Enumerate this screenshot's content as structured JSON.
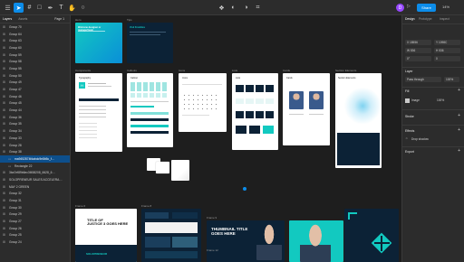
{
  "toolbar": {
    "icons": [
      "menu-icon",
      "move-icon",
      "frame-icon",
      "shape-icon",
      "pen-icon",
      "text-icon",
      "hand-icon",
      "comment-icon",
      "component-icon",
      "mask-icon",
      "contrast-icon",
      "crop-icon"
    ],
    "avatar_initial": "D",
    "share_label": "Share",
    "zoom": "14%"
  },
  "left": {
    "tabs": [
      "Layers",
      "Assets"
    ],
    "page_label": "Page 1",
    "layers": [
      {
        "name": "Group 70",
        "sel": false,
        "sub": false
      },
      {
        "name": "Group 64",
        "sel": false,
        "sub": false
      },
      {
        "name": "Group 63",
        "sel": false,
        "sub": false
      },
      {
        "name": "Group 60",
        "sel": false,
        "sub": false
      },
      {
        "name": "Group 59",
        "sel": false,
        "sub": false
      },
      {
        "name": "Group 58",
        "sel": false,
        "sub": false
      },
      {
        "name": "Group 55",
        "sel": false,
        "sub": false
      },
      {
        "name": "Group 50",
        "sel": false,
        "sub": false
      },
      {
        "name": "Group 49",
        "sel": false,
        "sub": false
      },
      {
        "name": "Group 47",
        "sel": false,
        "sub": false
      },
      {
        "name": "Group 46",
        "sel": false,
        "sub": false
      },
      {
        "name": "Group 45",
        "sel": false,
        "sub": false
      },
      {
        "name": "Group 44",
        "sel": false,
        "sub": false
      },
      {
        "name": "Group 36",
        "sel": false,
        "sub": false
      },
      {
        "name": "Group 35",
        "sel": false,
        "sub": false
      },
      {
        "name": "Group 34",
        "sel": false,
        "sub": false
      },
      {
        "name": "Group 33",
        "sel": false,
        "sub": false
      },
      {
        "name": "Group 28",
        "sel": false,
        "sub": false
      },
      {
        "name": "Group 38",
        "sel": false,
        "sub": false
      },
      {
        "name": "ma9452874fdabdc9e8b5c_f…",
        "sel": true,
        "sub": true
      },
      {
        "name": "Rectangle 22",
        "sel": false,
        "sub": true
      },
      {
        "name": "3ba7ef89b6ec3f458208_6628_6…",
        "sel": false,
        "sub": false
      },
      {
        "name": "SOLOPRENEUR SALES ACCELERA…",
        "sel": false,
        "sub": false
      },
      {
        "name": "MAY 2 GREEN",
        "sel": false,
        "sub": false
      },
      {
        "name": "Group 32",
        "sel": false,
        "sub": false
      },
      {
        "name": "Group 31",
        "sel": false,
        "sub": false
      },
      {
        "name": "Group 30",
        "sel": false,
        "sub": false
      },
      {
        "name": "Group 29",
        "sel": false,
        "sub": false
      },
      {
        "name": "Group 27",
        "sel": false,
        "sub": false
      },
      {
        "name": "Group 26",
        "sel": false,
        "sub": false
      },
      {
        "name": "Group 25",
        "sel": false,
        "sub": false
      },
      {
        "name": "Group 24",
        "sel": false,
        "sub": false
      }
    ]
  },
  "canvas": {
    "labels": {
      "hero": "Hero",
      "tips": "Tips",
      "components": "Components",
      "callouts": "Callouts",
      "icons": "Icons",
      "lists": "Lists",
      "cards": "Cards",
      "section_elements": "Section Elements",
      "frame6": "Frame 6",
      "frame8": "Frame 8",
      "frame9": "Frame 9",
      "frame10": "Frame 10",
      "frame12": "Frame 12"
    },
    "hero_title": "Welcome designer or manager/team",
    "tips_title": "Visit Frambles",
    "comp_heading": "Typography",
    "callouts_heading": "Callout",
    "icons_heading": "Icons",
    "lists_heading": "Lists",
    "cards_heading": "Cards",
    "section_heading": "Section Elements",
    "thumb1_title": "TITLE OF\nJUSTICE 3 GOES HERE",
    "thumb_main_title": "THUMBNAIL TITLE\nGOES HERE",
    "thumb_bottom_text": "SOLOPRENEUR"
  },
  "right": {
    "tabs": [
      "Design",
      "Prototype",
      "Inspect"
    ],
    "x": "X 18556",
    "y": "Y 1098C",
    "w": "W 536",
    "h": "H 536",
    "rot": "0°",
    "radius": "0",
    "layer_label": "Layer",
    "blend": "Pass through",
    "opacity": "100%",
    "fill_label": "Fill",
    "fill_value": "Image",
    "fill_pct": "100%",
    "stroke_label": "Stroke",
    "effects_label": "Effects",
    "effect_value": "Drop shadow",
    "export_label": "Export",
    "colors": {
      "accent": "#0c8ce9",
      "share": "#0c8ce9",
      "avatar": "#9747ff",
      "selection": "#0d4f8c"
    }
  }
}
